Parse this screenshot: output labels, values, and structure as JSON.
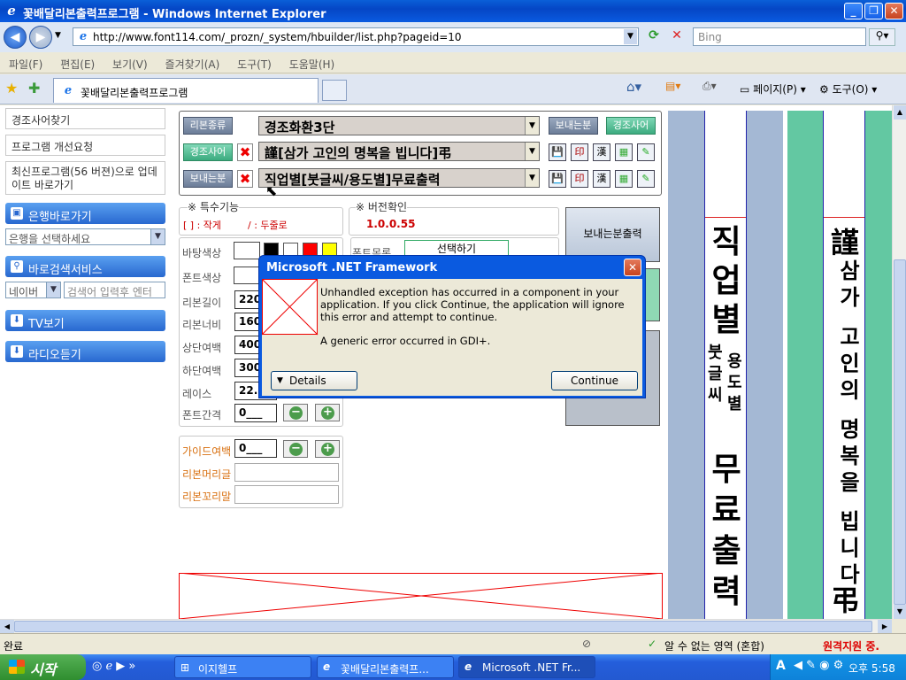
{
  "window": {
    "title": "꽃배달리본출력프로그램 - Windows Internet Explorer"
  },
  "address": {
    "url": "http://www.font114.com/_prozn/_system/hbuilder/list.php?pageid=10",
    "search_placeholder": "Bing"
  },
  "menu": [
    "파일(F)",
    "편집(E)",
    "보기(V)",
    "즐겨찾기(A)",
    "도구(T)",
    "도움말(H)"
  ],
  "tab": {
    "label": "꽃배달리본출력프로그램"
  },
  "toolbar": {
    "page": "페이지(P)",
    "tools": "도구(O)"
  },
  "sidebar": {
    "links": [
      "경조사어찾기",
      "프로그램 개선요청",
      "최신프로그램(56 버젼)으로 업데이트 바로가기"
    ],
    "bank_header": "은행바로가기",
    "bank_select": "은행을 선택하세요",
    "search_header": "바로검색서비스",
    "search_engine": "네이버",
    "search_placeholder": "검색어 입력후 엔터",
    "tv": "TV보기",
    "radio": "라디오듣기"
  },
  "app": {
    "btn_ribbon_type": "리본종류",
    "combo_type": "경조화환3단",
    "btn_sender": "보내는분",
    "btn_phrase": "경조사어",
    "combo_phrase": "謹[삼가 고인의 명복을 빕니다]弔",
    "combo_sender": "직업별[붓글씨/용도별]무료출력",
    "special_title": "※ 특수기능",
    "special_a": "[ ] : 작게",
    "special_b": "/ : 두줄로",
    "version_title": "※ 버전확인",
    "version": "1.0.0.55",
    "sender_print": "보내는분출력",
    "bg_color": "바탕색상",
    "font_color": "폰트색상",
    "font_list": "폰트목록",
    "select_btn": "선택하기",
    "length": "리본길이",
    "length_val": "220",
    "width": "리본너비",
    "width_val": "160",
    "top_margin": "상단여백",
    "top_margin_val": "400",
    "bottom_margin": "하단여백",
    "bottom_margin_val": "300",
    "lace": "레이스",
    "lace_val": "22.",
    "font_spacing": "폰트간격",
    "font_spacing_val": "0___",
    "guide_margin": "가이드여백",
    "guide_margin_val": "0___",
    "header_text": "리본머리글",
    "footer_text": "리본꼬리말",
    "icon_hanja": "漢"
  },
  "preview": {
    "left_ribbon": [
      "직",
      "업",
      "별",
      "붓글씨",
      "용도별",
      "무",
      "료",
      "출",
      "력"
    ],
    "right_ribbon_top": "謹",
    "right_ribbon_text": "삼가 고인의 명복을 빕니다",
    "right_ribbon_bottom": "弔"
  },
  "dialog": {
    "title": "Microsoft .NET Framework",
    "message": "Unhandled exception has occurred in a component in your application. If you click Continue, the application will ignore this error and attempt to continue.",
    "detail": "A generic error occurred in GDI+.",
    "details_btn": "Details",
    "continue_btn": "Continue"
  },
  "status": {
    "left": "완료",
    "zone": "알 수 없는 영역 (혼합)",
    "right": "원격지원 중."
  },
  "taskbar": {
    "start": "시작",
    "tasks": [
      "이지헬프",
      "꽃배달리본출력프...",
      "Microsoft .NET Fr..."
    ],
    "time": "오후 5:58"
  }
}
